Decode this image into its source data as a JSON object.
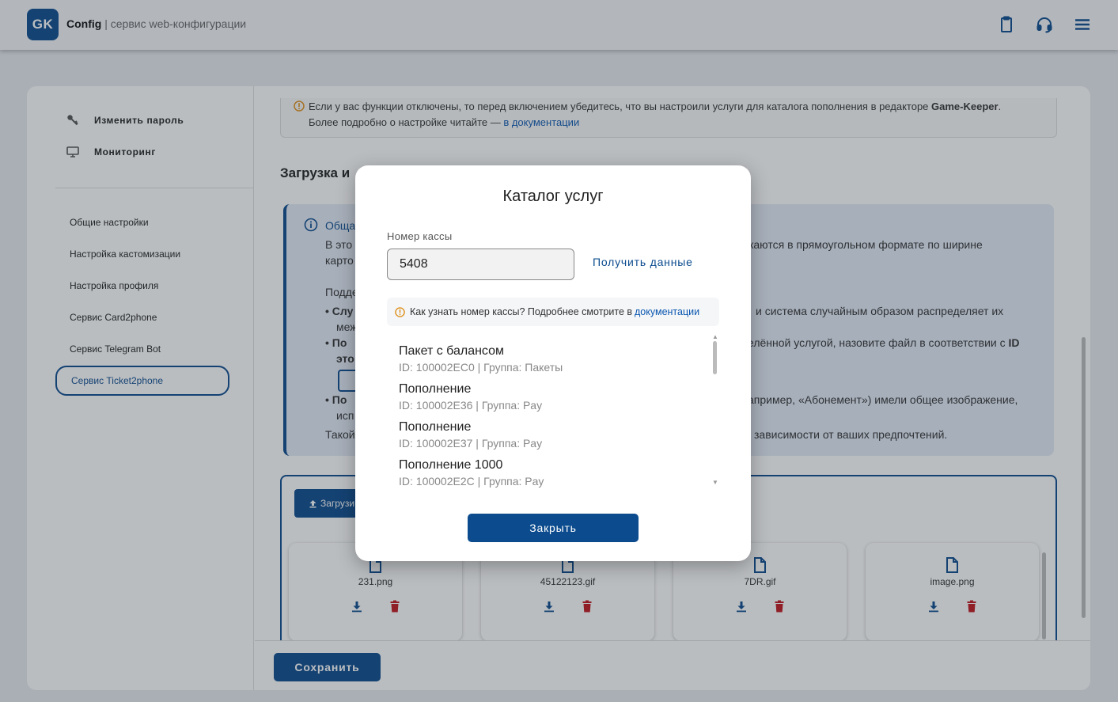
{
  "header": {
    "logo_text": "GK",
    "app_name": "Config",
    "app_subtitle": " | сервис web-конфигурации",
    "icons": [
      "clipboard-icon",
      "headset-icon",
      "menu-icon"
    ]
  },
  "sidebar": {
    "top_items": [
      {
        "label": "Изменить пароль",
        "icon": "key-icon"
      },
      {
        "label": "Мониторинг",
        "icon": "monitor-icon"
      }
    ],
    "items": [
      {
        "label": "Общие настройки"
      },
      {
        "label": "Настройка кастомизации"
      },
      {
        "label": "Настройка профиля"
      },
      {
        "label": "Сервис Card2phone"
      },
      {
        "label": "Сервис Telegram Bot"
      },
      {
        "label": "Сервис Ticket2phone",
        "active": true
      }
    ]
  },
  "main": {
    "warning": {
      "line1_prefix": "Если у вас функции отключены, то перед включением убедитесь, что вы настроили услуги для каталога пополнения в редакторе ",
      "line1_bold": "Game-Keeper",
      "line1_suffix": ".",
      "line2_prefix": "Более подробно о настройке читайте — ",
      "line2_link": "в документации"
    },
    "section_title": "Загрузка и",
    "info": {
      "heading": "Обща",
      "p1a": "В это",
      "p1b": "карто",
      "p1_right": "жаются в прямоугольном формате по ширине",
      "p2": "Подде",
      "b1a": "Слу",
      "b1b": "меж",
      "b1_right": "и система случайным образом распределяет их",
      "b2a": "По",
      "b2b": "это",
      "b2_right_prefix": "елённой услугой, назовите файл в соответствии с ",
      "b2_right_bold": "ID",
      "b3a": "По",
      "b3b": "исп",
      "b3_right": "апример, «Абонемент») имели общее изображение,",
      "last": "Такой",
      "last_right": "зависимости от ваших предпочтений."
    },
    "upload_label": "Загрузи",
    "files": [
      {
        "name": "231.png"
      },
      {
        "name": "45122123.gif"
      },
      {
        "name": "7DR.gif"
      },
      {
        "name": "image.png"
      }
    ],
    "save_label": "Сохранить"
  },
  "modal": {
    "title": "Каталог услуг",
    "field_label": "Номер кассы",
    "field_value": "5408",
    "get_data_label": "Получить данные",
    "hint_prefix": "Как узнать номер кассы? Подробнее смотрите в ",
    "hint_link": "документации",
    "items": [
      {
        "name": "Пакет с балансом",
        "sub": "ID: 100002EC0 | Группа: Пакеты"
      },
      {
        "name": "Пополнение",
        "sub": "ID: 100002E36 | Группа: Pay"
      },
      {
        "name": "Пополнение",
        "sub": "ID: 100002E37 | Группа: Pay"
      },
      {
        "name": "Пополнение 1000",
        "sub": "ID: 100002E2C | Группа: Pay"
      }
    ],
    "close_label": "Закрыть"
  },
  "colors": {
    "primary": "#0b4b8e",
    "danger": "#c0161c",
    "warning": "#e0901a",
    "info_bg": "#e3ebf6"
  }
}
